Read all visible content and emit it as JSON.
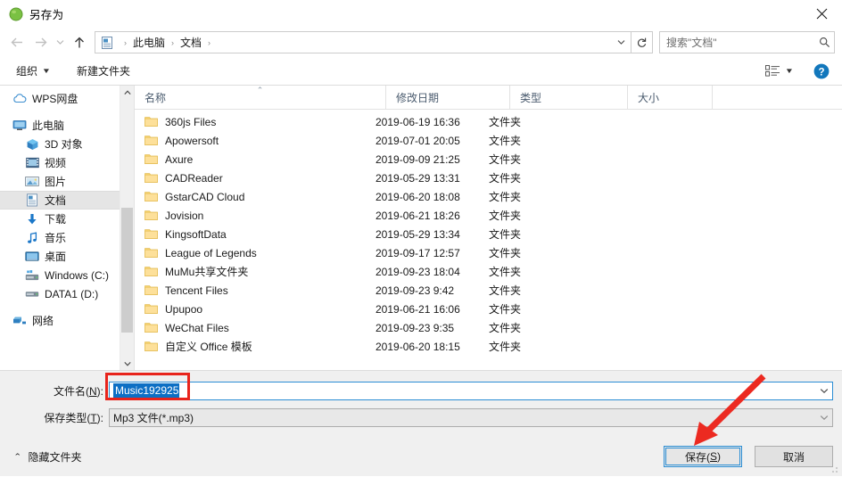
{
  "window": {
    "title": "另存为",
    "icon": "wps-green-circle-icon",
    "close_label": "✕"
  },
  "nav": {
    "back": "←",
    "forward": "→",
    "recent": "⌄",
    "up": "↑",
    "breadcrumb": [
      "此电脑",
      "文档"
    ],
    "breadcrumb_sep": "›",
    "dropdown": "⌄",
    "refresh": "↻",
    "search_placeholder": "搜索\"文档\""
  },
  "toolbar": {
    "organize_label": "组织",
    "new_folder_label": "新建文件夹",
    "view_caret": "▼",
    "help_label": "?"
  },
  "sidebar": {
    "items": [
      {
        "label": "WPS网盘",
        "icon": "cloud-icon",
        "indent": false,
        "selected": false
      },
      {
        "label": "此电脑",
        "icon": "monitor-icon",
        "indent": false,
        "selected": false
      },
      {
        "label": "3D 对象",
        "icon": "cube-icon",
        "indent": true,
        "selected": false
      },
      {
        "label": "视频",
        "icon": "video-icon",
        "indent": true,
        "selected": false
      },
      {
        "label": "图片",
        "icon": "picture-icon",
        "indent": true,
        "selected": false
      },
      {
        "label": "文档",
        "icon": "document-icon",
        "indent": true,
        "selected": true
      },
      {
        "label": "下载",
        "icon": "download-icon",
        "indent": true,
        "selected": false
      },
      {
        "label": "音乐",
        "icon": "music-icon",
        "indent": true,
        "selected": false
      },
      {
        "label": "桌面",
        "icon": "desktop-icon",
        "indent": true,
        "selected": false
      },
      {
        "label": "Windows (C:)",
        "icon": "windows-drive-icon",
        "indent": true,
        "selected": false
      },
      {
        "label": "DATA1 (D:)",
        "icon": "drive-icon",
        "indent": true,
        "selected": false
      },
      {
        "label": "网络",
        "icon": "network-icon",
        "indent": false,
        "selected": false
      }
    ]
  },
  "filelist": {
    "columns": {
      "name": "名称",
      "date": "修改日期",
      "type": "类型",
      "size": "大小"
    },
    "sort_indicator": "⌃",
    "rows": [
      {
        "name": "360js Files",
        "date": "2019-06-19 16:36",
        "type": "文件夹",
        "size": ""
      },
      {
        "name": "Apowersoft",
        "date": "2019-07-01 20:05",
        "type": "文件夹",
        "size": ""
      },
      {
        "name": "Axure",
        "date": "2019-09-09 21:25",
        "type": "文件夹",
        "size": ""
      },
      {
        "name": "CADReader",
        "date": "2019-05-29 13:31",
        "type": "文件夹",
        "size": ""
      },
      {
        "name": "GstarCAD Cloud",
        "date": "2019-06-20 18:08",
        "type": "文件夹",
        "size": ""
      },
      {
        "name": "Jovision",
        "date": "2019-06-21 18:26",
        "type": "文件夹",
        "size": ""
      },
      {
        "name": "KingsoftData",
        "date": "2019-05-29 13:34",
        "type": "文件夹",
        "size": ""
      },
      {
        "name": "League of Legends",
        "date": "2019-09-17 12:57",
        "type": "文件夹",
        "size": ""
      },
      {
        "name": "MuMu共享文件夹",
        "date": "2019-09-23 18:04",
        "type": "文件夹",
        "size": ""
      },
      {
        "name": "Tencent Files",
        "date": "2019-09-23 9:42",
        "type": "文件夹",
        "size": ""
      },
      {
        "name": "Upupoo",
        "date": "2019-06-21 16:06",
        "type": "文件夹",
        "size": ""
      },
      {
        "name": "WeChat Files",
        "date": "2019-09-23 9:35",
        "type": "文件夹",
        "size": ""
      },
      {
        "name": "自定义 Office 模板",
        "date": "2019-06-20 18:15",
        "type": "文件夹",
        "size": ""
      }
    ]
  },
  "form": {
    "filename_label_a": "文件名(",
    "filename_label_key": "N",
    "filename_label_b": "):",
    "filename_value": "Music192925",
    "filetype_label_a": "保存类型(",
    "filetype_label_key": "T",
    "filetype_label_b": "):",
    "filetype_value": "Mp3 文件(*.mp3)",
    "dropdown_glyph": "⌄"
  },
  "footer": {
    "hide_folders_label": "隐藏文件夹",
    "chevron": "⌃",
    "save_label_a": "保存(",
    "save_label_key": "S",
    "save_label_b": ")",
    "cancel_label": "取消"
  },
  "colors": {
    "accent_blue": "#2a8dd4",
    "selection_blue": "#0d6fc4",
    "annotation_red": "#e8241c",
    "folder_yellow": "#fbd872",
    "panel_grey": "#f0f0f0"
  }
}
